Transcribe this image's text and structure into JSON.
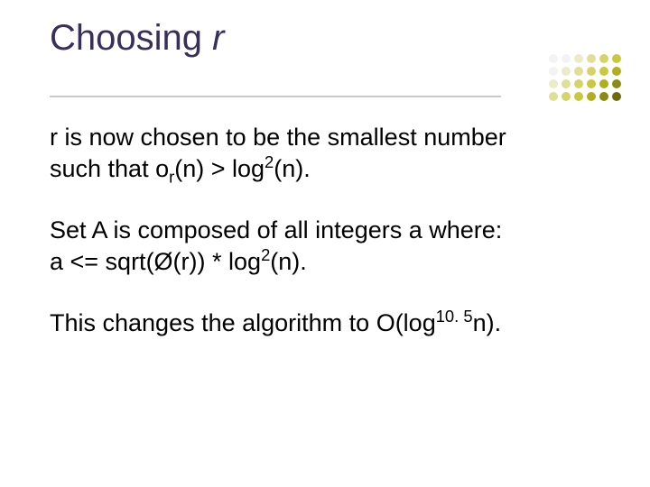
{
  "title": {
    "pre": "Choosing ",
    "ital": "r"
  },
  "p1": {
    "l1": "r is now chosen to be the smallest number",
    "l2a": "such that o",
    "l2_sub": "r",
    "l2b": "(n) > log",
    "l2_sup": "2",
    "l2c": "(n)."
  },
  "p2": {
    "l1": "Set A is composed of all integers a where:",
    "l2a": "a <= sqrt(Ø(r)) * log",
    "l2_sup": "2",
    "l2b": "(n)."
  },
  "p3": {
    "a": "This changes the algorithm to O(log",
    "sup": "10. 5",
    "b": "n)."
  },
  "dot_colors": [
    "#f3f3f3",
    "#f3f3f3",
    "#ecebc9",
    "#e0df98",
    "#d5d46a",
    "#c9c83e",
    "#f3f3f3",
    "#ecebc9",
    "#e0df98",
    "#d5d46a",
    "#c9c83e",
    "#b0af1f",
    "#ecebc9",
    "#e0df98",
    "#d5d46a",
    "#c9c83e",
    "#b0af1f",
    "#8a8a14",
    "#e0df98",
    "#d5d46a",
    "#c9c83e",
    "#b0af1f",
    "#8a8a14",
    "#6b6b0e"
  ]
}
